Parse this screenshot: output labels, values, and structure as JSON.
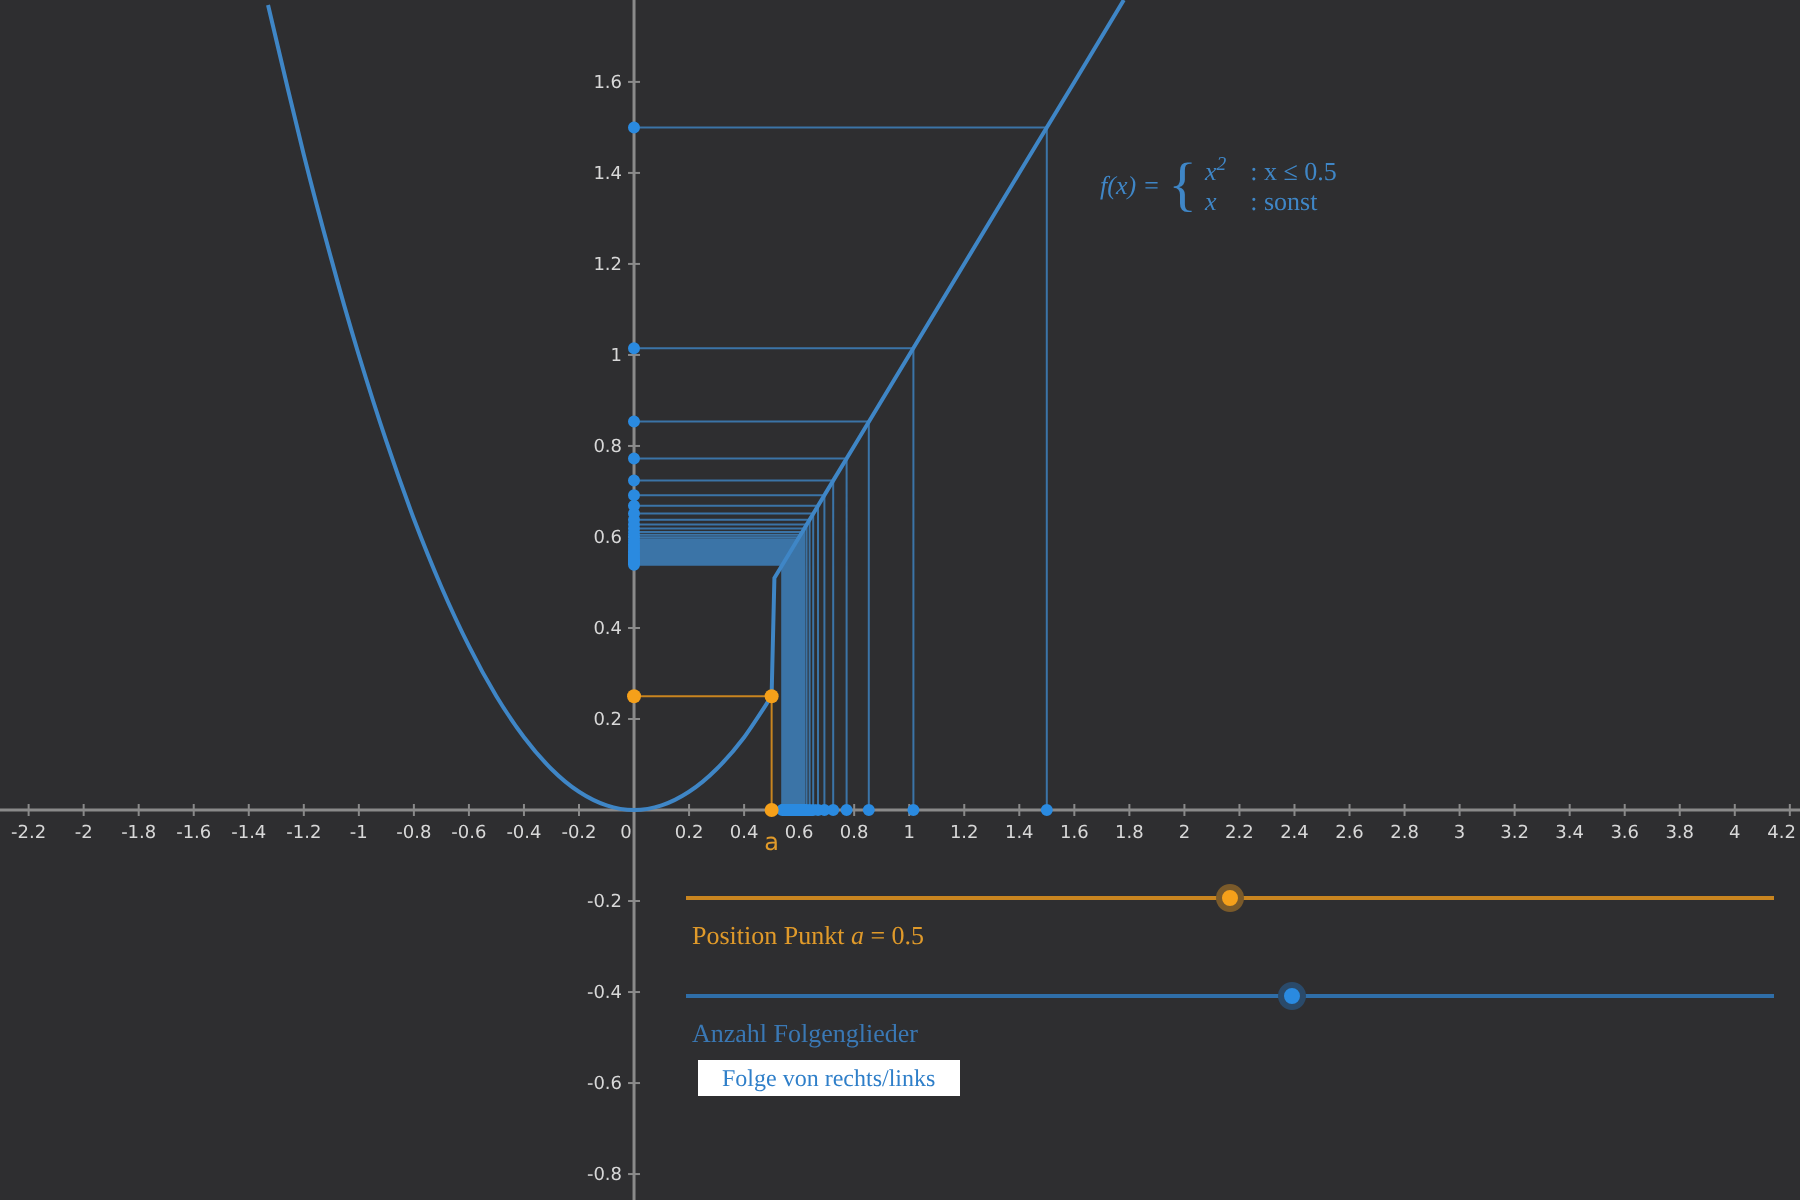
{
  "plot": {
    "chart_data": {
      "type": "line",
      "xlim": [
        -2.304,
        4.237
      ],
      "ylim": [
        -0.857,
        1.78
      ],
      "xticks": [
        -2.2,
        -2,
        -1.8,
        -1.6,
        -1.4,
        -1.2,
        -1,
        -0.8,
        -0.6,
        -0.4,
        -0.2,
        0,
        0.2,
        0.4,
        0.6,
        0.8,
        1,
        1.2,
        1.4,
        1.6,
        1.8,
        2,
        2.2,
        2.4,
        2.6,
        2.8,
        3,
        3.2,
        3.4,
        3.6,
        3.8,
        4,
        4.2
      ],
      "yticks": [
        -0.8,
        -0.6,
        -0.4,
        -0.2,
        0.2,
        0.4,
        0.6,
        0.8,
        1,
        1.2,
        1.4,
        1.6
      ],
      "x": [
        -1.33,
        -1.2,
        -1.1,
        -1,
        -0.9,
        -0.8,
        -0.7,
        -0.6,
        -0.5,
        -0.4,
        -0.3,
        -0.2,
        -0.1,
        0,
        0.1,
        0.2,
        0.3,
        0.4,
        0.5,
        0.51,
        0.6,
        0.8,
        1,
        1.2,
        1.4,
        1.6,
        1.78
      ],
      "series": [
        {
          "color": "#3f86c6",
          "values": [
            1.769,
            1.44,
            1.21,
            1,
            0.81,
            0.64,
            0.49,
            0.36,
            0.25,
            0.16,
            0.09,
            0.04,
            0.01,
            0,
            0.01,
            0.04,
            0.09,
            0.16,
            0.25,
            0.51,
            0.6,
            0.8,
            1,
            1.2,
            1.4,
            1.6,
            1.78
          ]
        }
      ]
    },
    "point_label": "a",
    "formula": {
      "lhs": "f(x) =",
      "brace": "{",
      "cases": [
        {
          "expr": "x$^{2}$",
          "condition": ": x ≤ 0.5"
        },
        {
          "expr": "x",
          "condition": ": sonst"
        }
      ]
    }
  },
  "sliders": [
    {
      "label": "Position Punkt *a* = 0.5",
      "color": "#c9851f",
      "level": 0.5
    },
    {
      "label": "Anzahl Folgenglieder",
      "color": "#2f6ea8",
      "level": 0.557
    }
  ],
  "button": {
    "label": "Folge von rechts/links"
  }
}
